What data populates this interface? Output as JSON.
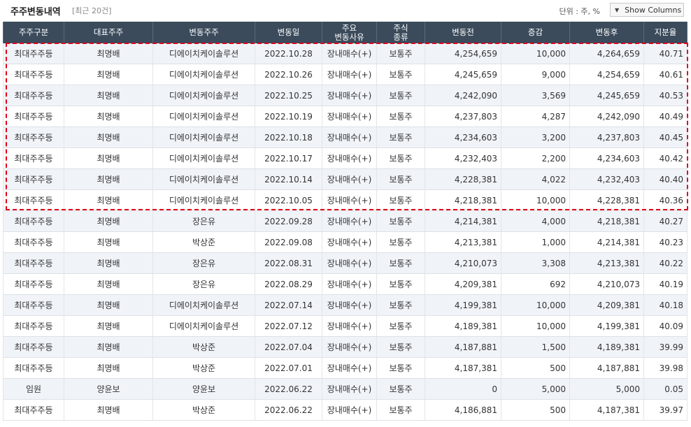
{
  "header": {
    "title": "주주변동내역",
    "count": "[최근 20건]",
    "unit": "단위 : 주, %",
    "show_columns": "Show Columns"
  },
  "table": {
    "columns": [
      "주주구분",
      "대표주주",
      "변동주주",
      "변동일",
      "주요\n변동사유",
      "주식\n종류",
      "변동전",
      "증감",
      "변동후",
      "지분율"
    ],
    "rows": [
      [
        "최대주주등",
        "최명배",
        "디에이치케이솔루션",
        "2022.10.28",
        "장내매수(+)",
        "보통주",
        "4,254,659",
        "10,000",
        "4,264,659",
        "40.71"
      ],
      [
        "최대주주등",
        "최명배",
        "디에이치케이솔루션",
        "2022.10.26",
        "장내매수(+)",
        "보통주",
        "4,245,659",
        "9,000",
        "4,254,659",
        "40.61"
      ],
      [
        "최대주주등",
        "최명배",
        "디에이치케이솔루션",
        "2022.10.25",
        "장내매수(+)",
        "보통주",
        "4,242,090",
        "3,569",
        "4,245,659",
        "40.53"
      ],
      [
        "최대주주등",
        "최명배",
        "디에이치케이솔루션",
        "2022.10.19",
        "장내매수(+)",
        "보통주",
        "4,237,803",
        "4,287",
        "4,242,090",
        "40.49"
      ],
      [
        "최대주주등",
        "최명배",
        "디에이치케이솔루션",
        "2022.10.18",
        "장내매수(+)",
        "보통주",
        "4,234,603",
        "3,200",
        "4,237,803",
        "40.45"
      ],
      [
        "최대주주등",
        "최명배",
        "디에이치케이솔루션",
        "2022.10.17",
        "장내매수(+)",
        "보통주",
        "4,232,403",
        "2,200",
        "4,234,603",
        "40.42"
      ],
      [
        "최대주주등",
        "최명배",
        "디에이치케이솔루션",
        "2022.10.14",
        "장내매수(+)",
        "보통주",
        "4,228,381",
        "4,022",
        "4,232,403",
        "40.40"
      ],
      [
        "최대주주등",
        "최명배",
        "디에이치케이솔루션",
        "2022.10.05",
        "장내매수(+)",
        "보통주",
        "4,218,381",
        "10,000",
        "4,228,381",
        "40.36"
      ],
      [
        "최대주주등",
        "최명배",
        "장은유",
        "2022.09.28",
        "장내매수(+)",
        "보통주",
        "4,214,381",
        "4,000",
        "4,218,381",
        "40.27"
      ],
      [
        "최대주주등",
        "최명배",
        "박상준",
        "2022.09.08",
        "장내매수(+)",
        "보통주",
        "4,213,381",
        "1,000",
        "4,214,381",
        "40.23"
      ],
      [
        "최대주주등",
        "최명배",
        "장은유",
        "2022.08.31",
        "장내매수(+)",
        "보통주",
        "4,210,073",
        "3,308",
        "4,213,381",
        "40.22"
      ],
      [
        "최대주주등",
        "최명배",
        "장은유",
        "2022.08.29",
        "장내매수(+)",
        "보통주",
        "4,209,381",
        "692",
        "4,210,073",
        "40.19"
      ],
      [
        "최대주주등",
        "최명배",
        "디에이치케이솔루션",
        "2022.07.14",
        "장내매수(+)",
        "보통주",
        "4,199,381",
        "10,000",
        "4,209,381",
        "40.18"
      ],
      [
        "최대주주등",
        "최명배",
        "디에이치케이솔루션",
        "2022.07.12",
        "장내매수(+)",
        "보통주",
        "4,189,381",
        "10,000",
        "4,199,381",
        "40.09"
      ],
      [
        "최대주주등",
        "최명배",
        "박상준",
        "2022.07.04",
        "장내매수(+)",
        "보통주",
        "4,187,881",
        "1,500",
        "4,189,381",
        "39.99"
      ],
      [
        "최대주주등",
        "최명배",
        "박상준",
        "2022.07.01",
        "장내매수(+)",
        "보통주",
        "4,187,381",
        "500",
        "4,187,881",
        "39.98"
      ],
      [
        "임원",
        "양윤보",
        "양윤보",
        "2022.06.22",
        "장내매수(+)",
        "보통주",
        "0",
        "5,000",
        "5,000",
        "0.05"
      ],
      [
        "최대주주등",
        "최명배",
        "박상준",
        "2022.06.22",
        "장내매수(+)",
        "보통주",
        "4,186,881",
        "500",
        "4,187,381",
        "39.97"
      ]
    ]
  },
  "colors": {
    "header_bg": "#3b4b5c",
    "row_alt_bg": "#f0f4f9",
    "highlight_border": "#e0001a"
  },
  "icons": {
    "show_columns": "triangle-down-icon"
  }
}
